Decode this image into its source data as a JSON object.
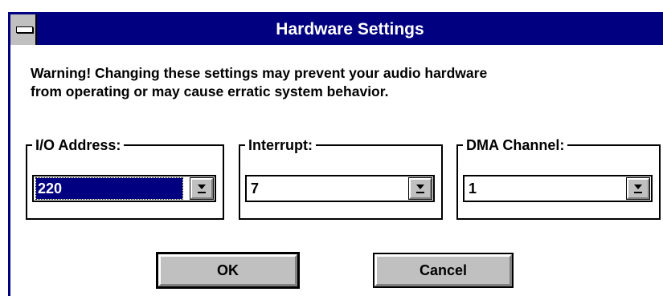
{
  "window": {
    "title": "Hardware Settings"
  },
  "warning": {
    "line1": "Warning!  Changing these settings may prevent your audio hardware",
    "line2": "from operating or may cause erratic system behavior."
  },
  "groups": {
    "io": {
      "label": "I/O Address:",
      "value": "220"
    },
    "irq": {
      "label": "Interrupt:",
      "value": "7"
    },
    "dma": {
      "label": "DMA Channel:",
      "value": "1"
    }
  },
  "buttons": {
    "ok": "OK",
    "cancel": "Cancel"
  },
  "colors": {
    "titlebar": "#000080",
    "face": "#c0c0c0",
    "selection": "#000080"
  },
  "icons": {
    "system_menu": "system-menu-icon",
    "dropdown": "dropdown-arrow-icon"
  }
}
